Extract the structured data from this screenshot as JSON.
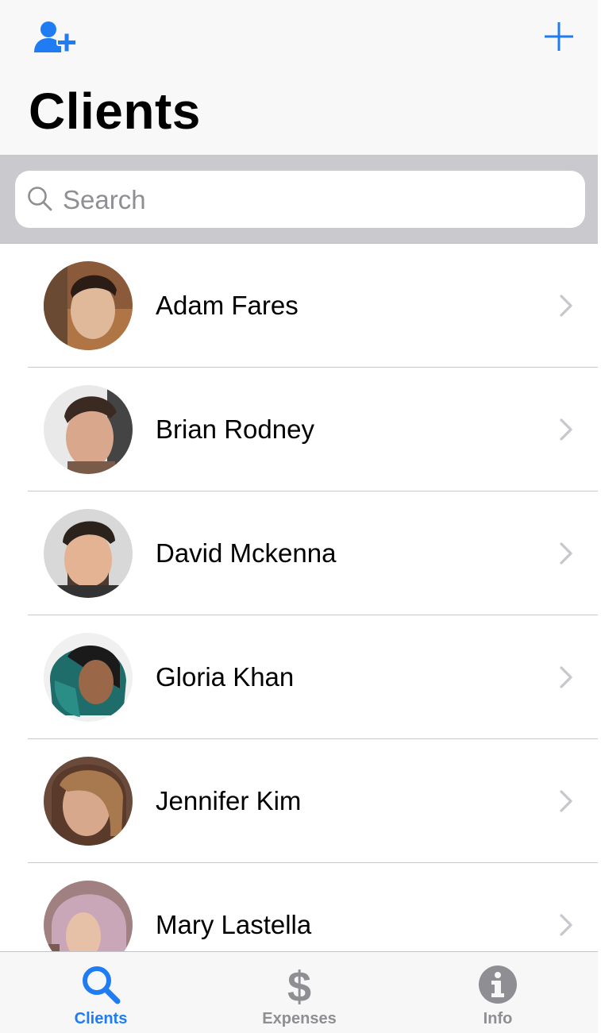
{
  "header": {
    "title": "Clients",
    "add_client_icon": "person-add-icon",
    "new_icon": "plus-icon",
    "accent": "#1f7cf3"
  },
  "search": {
    "placeholder": "Search",
    "value": ""
  },
  "clients": [
    {
      "name": "Adam Fares"
    },
    {
      "name": "Brian Rodney"
    },
    {
      "name": "David Mckenna"
    },
    {
      "name": "Gloria Khan"
    },
    {
      "name": "Jennifer Kim"
    },
    {
      "name": "Mary Lastella"
    }
  ],
  "tabs": [
    {
      "label": "Clients",
      "icon": "search-icon",
      "active": true
    },
    {
      "label": "Expenses",
      "icon": "dollar-icon",
      "active": false
    },
    {
      "label": "Info",
      "icon": "info-icon",
      "active": false
    }
  ],
  "colors": {
    "active_tab": "#1f7cf3",
    "inactive_tab": "#8e8e93"
  }
}
